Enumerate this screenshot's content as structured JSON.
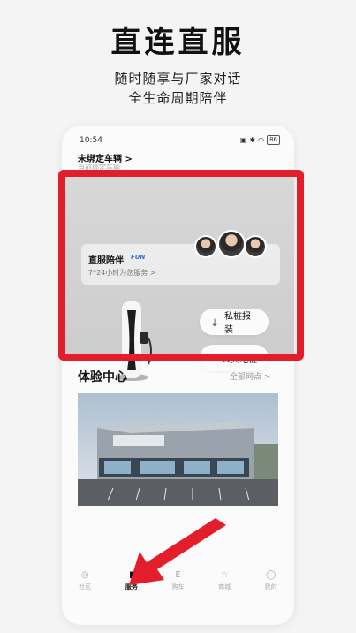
{
  "promo": {
    "headline": "直连直服",
    "subline_1": "随时随享与厂家对话",
    "subline_2": "全生命周期陪伴"
  },
  "status_bar": {
    "time": "10:54",
    "battery": "86"
  },
  "vehicle": {
    "title": "未绑定车辆 >",
    "subtitle": "当前绑定车辆"
  },
  "service_card": {
    "title": "直服陪伴",
    "logo_text": "FUN",
    "subtitle": "7*24小时为您服务 >",
    "private_charger_label": "私桩报装",
    "public_charger_label": "公共电桩"
  },
  "experience": {
    "title": "体验中心",
    "all_link": "全部网点 >"
  },
  "tabbar": {
    "items": [
      {
        "label": "社区",
        "icon": "compass-icon"
      },
      {
        "label": "服务",
        "icon": "bookmark-icon"
      },
      {
        "label": "购车",
        "icon": "e-brand-icon"
      },
      {
        "label": "商城",
        "icon": "star-icon"
      },
      {
        "label": "我的",
        "icon": "profile-icon"
      }
    ],
    "active": "服务"
  },
  "colors": {
    "highlight": "#e31e2b",
    "background": "#f4f4f4",
    "logo_blue": "#3a6fd8"
  }
}
